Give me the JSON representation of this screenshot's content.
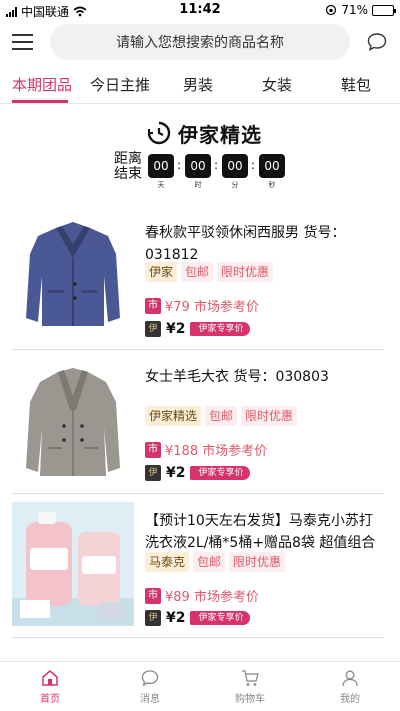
{
  "status_bar": {
    "carrier": "中国联通",
    "time": "11:42",
    "battery": "71%",
    "battery_level": 0.71
  },
  "header": {
    "search_placeholder": "请输入您想搜索的商品名称"
  },
  "tabs": [
    {
      "label": "本期团品",
      "active": true
    },
    {
      "label": "今日主推",
      "active": false
    },
    {
      "label": "男装",
      "active": false
    },
    {
      "label": "女装",
      "active": false
    },
    {
      "label": "鞋包",
      "active": false
    }
  ],
  "promo": {
    "title": "伊家精选",
    "countdown_label": "距离结束",
    "countdown": [
      {
        "value": "00",
        "unit": "天"
      },
      {
        "value": "00",
        "unit": "时"
      },
      {
        "value": "00",
        "unit": "分"
      },
      {
        "value": "00",
        "unit": "秒"
      }
    ]
  },
  "products": [
    {
      "name": "春秋款平驳领休闲西服男 货号：031812",
      "image": "blue-blazer",
      "tags": [
        "伊家",
        "包邮",
        "限时优惠"
      ],
      "market_price": "¥79 市场参考价",
      "market_icon": "市",
      "yj_price": "¥2",
      "yj_badge": "伊家专享价"
    },
    {
      "name": "女士羊毛大衣 货号：030803",
      "image": "grey-wool-coat",
      "tags": [
        "伊家精选",
        "包邮",
        "限时优惠"
      ],
      "market_price": "¥188 市场参考价",
      "market_icon": "市",
      "yj_price": "¥2",
      "yj_badge": "伊家专享价"
    },
    {
      "name": "【预计10天左右发货】马泰克小苏打洗衣液2L/桶*5桶+赠品8袋 超值组合",
      "image": "laundry-detergent",
      "tags": [
        "马泰克",
        "包邮",
        "限时优惠"
      ],
      "market_price": "¥89 市场参考价",
      "market_icon": "市",
      "yj_price": "¥2",
      "yj_badge": "伊家专享价"
    }
  ],
  "bottom_nav": [
    {
      "label": "首页",
      "icon": "home-icon",
      "active": true
    },
    {
      "label": "消息",
      "icon": "message-icon",
      "active": false
    },
    {
      "label": "购物车",
      "icon": "cart-icon",
      "active": false
    },
    {
      "label": "我的",
      "icon": "user-icon",
      "active": false
    }
  ],
  "colors": {
    "accent": "#d6336c",
    "tag_pink_text": "#e05a6a",
    "tag_brand_bg": "#fcefd8"
  }
}
